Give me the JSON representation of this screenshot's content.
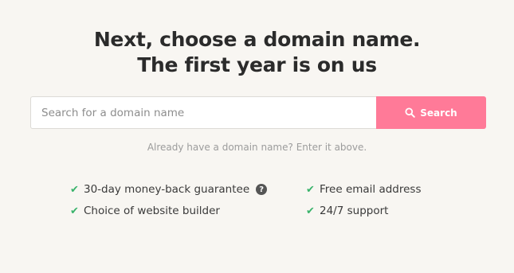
{
  "headline": {
    "line1": "Next, choose a domain name.",
    "line2": "The first year is on us"
  },
  "search": {
    "placeholder": "Search for a domain name",
    "value": "",
    "button_label": "Search",
    "button_icon": "search-icon"
  },
  "hint": "Already have a domain name? Enter it above.",
  "features": [
    {
      "label": "30-day money-back guarantee",
      "icon": "check-icon",
      "has_help": true
    },
    {
      "label": "Free email address",
      "icon": "check-icon"
    },
    {
      "label": "Choice of website builder",
      "icon": "check-icon"
    },
    {
      "label": "24/7 support",
      "icon": "check-icon"
    }
  ],
  "colors": {
    "background": "#f8f6f2",
    "accent": "#ff7a98",
    "check": "#39b36b"
  }
}
